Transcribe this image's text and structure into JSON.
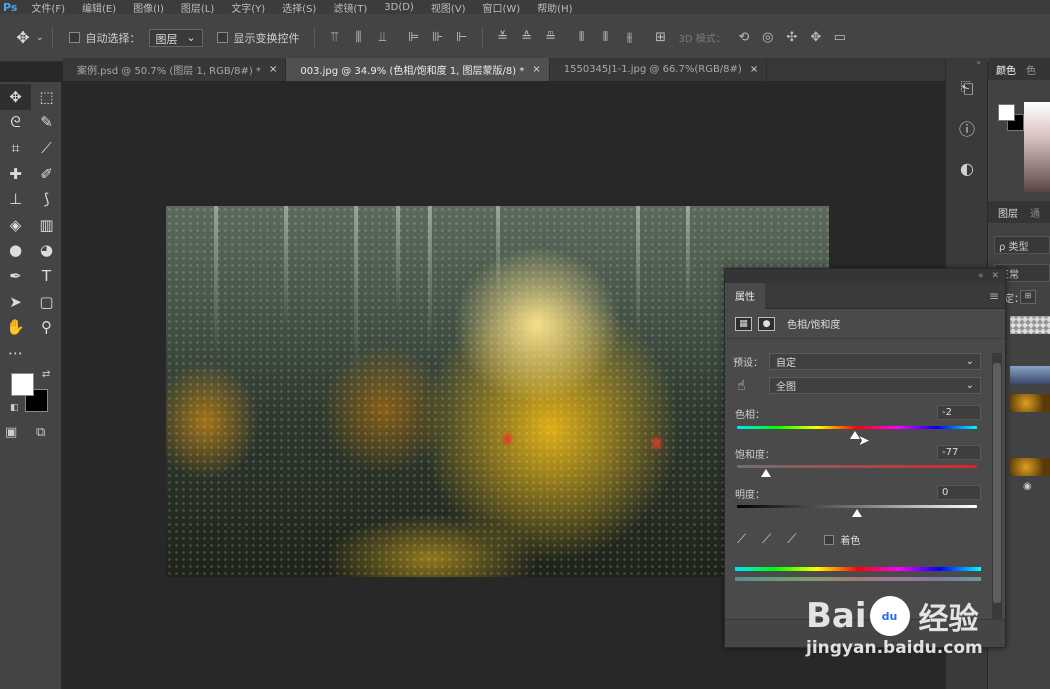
{
  "app": {
    "logo": "Ps"
  },
  "menu": [
    "文件(F)",
    "编辑(E)",
    "图像(I)",
    "图层(L)",
    "文字(Y)",
    "选择(S)",
    "滤镜(T)",
    "3D(D)",
    "视图(V)",
    "窗口(W)",
    "帮助(H)"
  ],
  "options": {
    "auto_select_label": "自动选择：",
    "auto_select_value": "图层",
    "show_transform_label": "显示变换控件",
    "mode3d_label": "3D 模式："
  },
  "tabs": [
    {
      "label": "案例.psd @ 50.7% (图层 1, RGB/8#) *",
      "close": "×"
    },
    {
      "label": "003.jpg @ 34.9% (色相/饱和度 1, 图层蒙版/8) *",
      "close": "×"
    },
    {
      "label": "1550345J1-1.jpg @ 66.7%(RGB/8#)",
      "close": "×"
    }
  ],
  "right_dock": {
    "color_tab": "颜色",
    "color_tab2": "色",
    "layers_tab": "图层",
    "layers_tab2": "通",
    "kind_label": "ρ 类型",
    "blend_mode": "正常",
    "lock_label": "锁定："
  },
  "properties": {
    "tab_title": "属性",
    "adjustment_name": "色相/饱和度",
    "preset_label": "预设：",
    "preset_value": "自定",
    "channel_value": "全图",
    "hue_label": "色相：",
    "hue_value": "-2",
    "hue_fraction": 0.49,
    "saturation_label": "饱和度：",
    "saturation_value": "-77",
    "saturation_fraction": 0.12,
    "lightness_label": "明度：",
    "lightness_value": "0",
    "lightness_fraction": 0.5,
    "colorize_label": "着色"
  },
  "watermark": {
    "brand_left": "Bai",
    "brand_paw": "du",
    "brand_right": "经验",
    "url": "jingyan.baidu.com"
  },
  "colors": {
    "accent": "#4aa3f0",
    "panel": "#4a4a4a",
    "canvas_bg": "#282828"
  }
}
